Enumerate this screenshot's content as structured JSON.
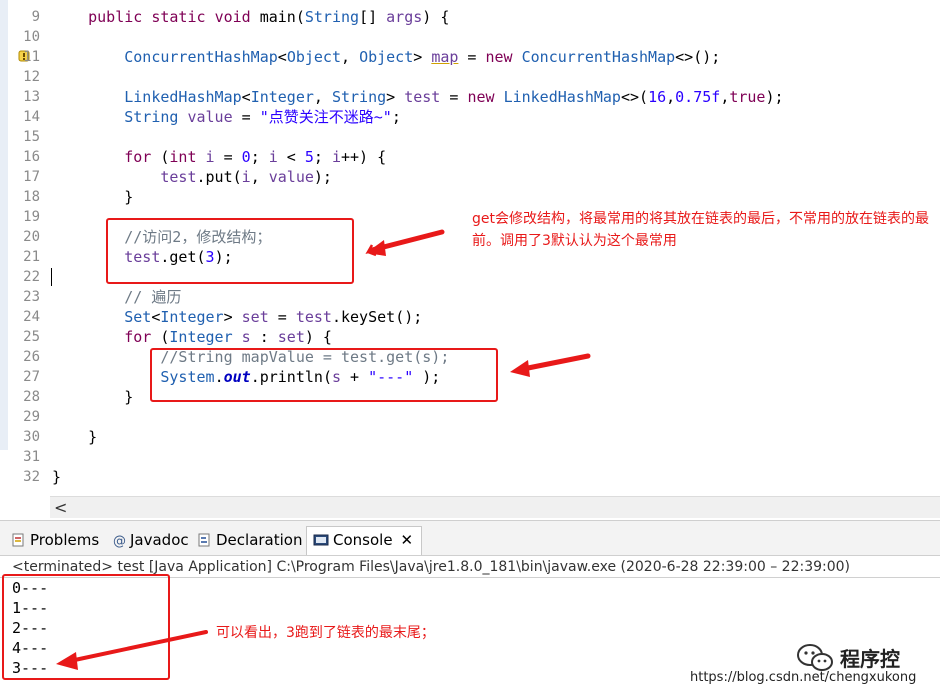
{
  "editor": {
    "lines": [
      {
        "no": "9",
        "code": "    public static void main(String[] args) {"
      },
      {
        "no": "10",
        "code": ""
      },
      {
        "no": "11",
        "code": "        ConcurrentHashMap<Object, Object> map = new ConcurrentHashMap<>();"
      },
      {
        "no": "12",
        "code": ""
      },
      {
        "no": "13",
        "code": "        LinkedHashMap<Integer, String> test = new LinkedHashMap<>(16,0.75f,true);"
      },
      {
        "no": "14",
        "code": "        String value = \"点赞关注不迷路~\";"
      },
      {
        "no": "15",
        "code": ""
      },
      {
        "no": "16",
        "code": "        for (int i = 0; i < 5; i++) {"
      },
      {
        "no": "17",
        "code": "            test.put(i, value);"
      },
      {
        "no": "18",
        "code": "        }"
      },
      {
        "no": "19",
        "code": ""
      },
      {
        "no": "20",
        "code": "        //访问2，修改结构；"
      },
      {
        "no": "21",
        "code": "        test.get(3);"
      },
      {
        "no": "22",
        "code": ""
      },
      {
        "no": "23",
        "code": "        // 遍历"
      },
      {
        "no": "24",
        "code": "        Set<Integer> set = test.keySet();"
      },
      {
        "no": "25",
        "code": "        for (Integer s : set) {"
      },
      {
        "no": "26",
        "code": "            //String mapValue = test.get(s);"
      },
      {
        "no": "27",
        "code": "            System.out.println(s + \"---\" );"
      },
      {
        "no": "28",
        "code": "        }"
      },
      {
        "no": "29",
        "code": ""
      },
      {
        "no": "30",
        "code": "    }"
      },
      {
        "no": "31",
        "code": ""
      },
      {
        "no": "32",
        "code": "}"
      }
    ],
    "scroll_left_glyph": "<"
  },
  "tabs": [
    {
      "label": "Problems",
      "icon": "problems-icon"
    },
    {
      "label": "Javadoc",
      "icon": "javadoc-icon"
    },
    {
      "label": "Declaration",
      "icon": "declaration-icon"
    },
    {
      "label": "Console",
      "icon": "console-icon",
      "active": true,
      "close": "✕"
    }
  ],
  "console": {
    "status": "<terminated> test [Java Application] C:\\Program Files\\Java\\jre1.8.0_181\\bin\\javaw.exe  (2020-6-28 22:39:00 – 22:39:00)",
    "output": [
      "0---",
      "1---",
      "2---",
      "4---",
      "3---"
    ]
  },
  "annotations": {
    "note1": "get会修改结构，将最常用的将其放在链表的最后，不常用的放在链表的最前。调用了3默认认为这个最常用",
    "note2": "可以看出，3跑到了链表的最末尾；"
  },
  "watermark": {
    "name": "程序控",
    "url": "https://blog.csdn.net/chengxukong"
  },
  "colors": {
    "keyword": "#7f0055",
    "type": "#2060b0",
    "string": "#2a00ff",
    "comment": "#6e7a86",
    "annotation": "#e81919"
  }
}
